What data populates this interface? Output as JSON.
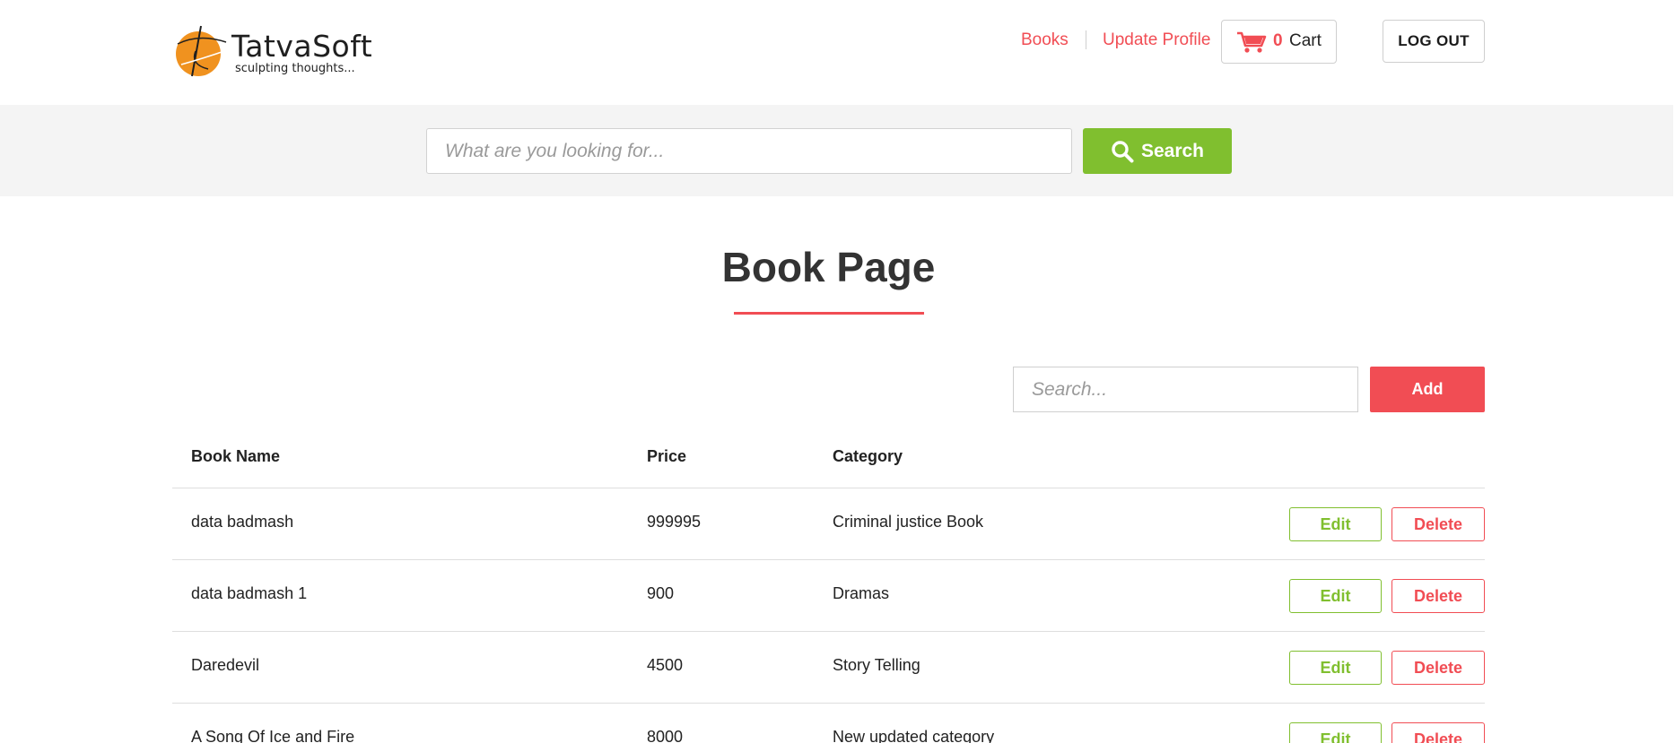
{
  "brand": {
    "name": "TatvaSoft",
    "tagline": "sculpting thoughts..."
  },
  "nav": {
    "books": "Books",
    "update_profile": "Update Profile",
    "cart_count": "0",
    "cart_label": "Cart",
    "logout": "LOG OUT"
  },
  "search": {
    "placeholder": "What are you looking for...",
    "button_label": "Search"
  },
  "page": {
    "title": "Book Page",
    "table_search_placeholder": "Search...",
    "add_label": "Add"
  },
  "table": {
    "headers": {
      "name": "Book Name",
      "price": "Price",
      "category": "Category"
    },
    "edit_label": "Edit",
    "delete_label": "Delete",
    "rows": [
      {
        "name": "data badmash",
        "price": "999995",
        "category": "Criminal justice Book"
      },
      {
        "name": "data badmash 1",
        "price": "900",
        "category": "Dramas"
      },
      {
        "name": "Daredevil",
        "price": "4500",
        "category": "Story Telling"
      },
      {
        "name": "A Song Of Ice and Fire",
        "price": "8000",
        "category": "New updated category"
      }
    ]
  },
  "colors": {
    "accent_red": "#f14d54",
    "accent_green": "#80bf2f"
  },
  "icons": {
    "logo": "tatvasoft-logo-icon",
    "cart": "cart-icon",
    "search": "search-icon"
  }
}
